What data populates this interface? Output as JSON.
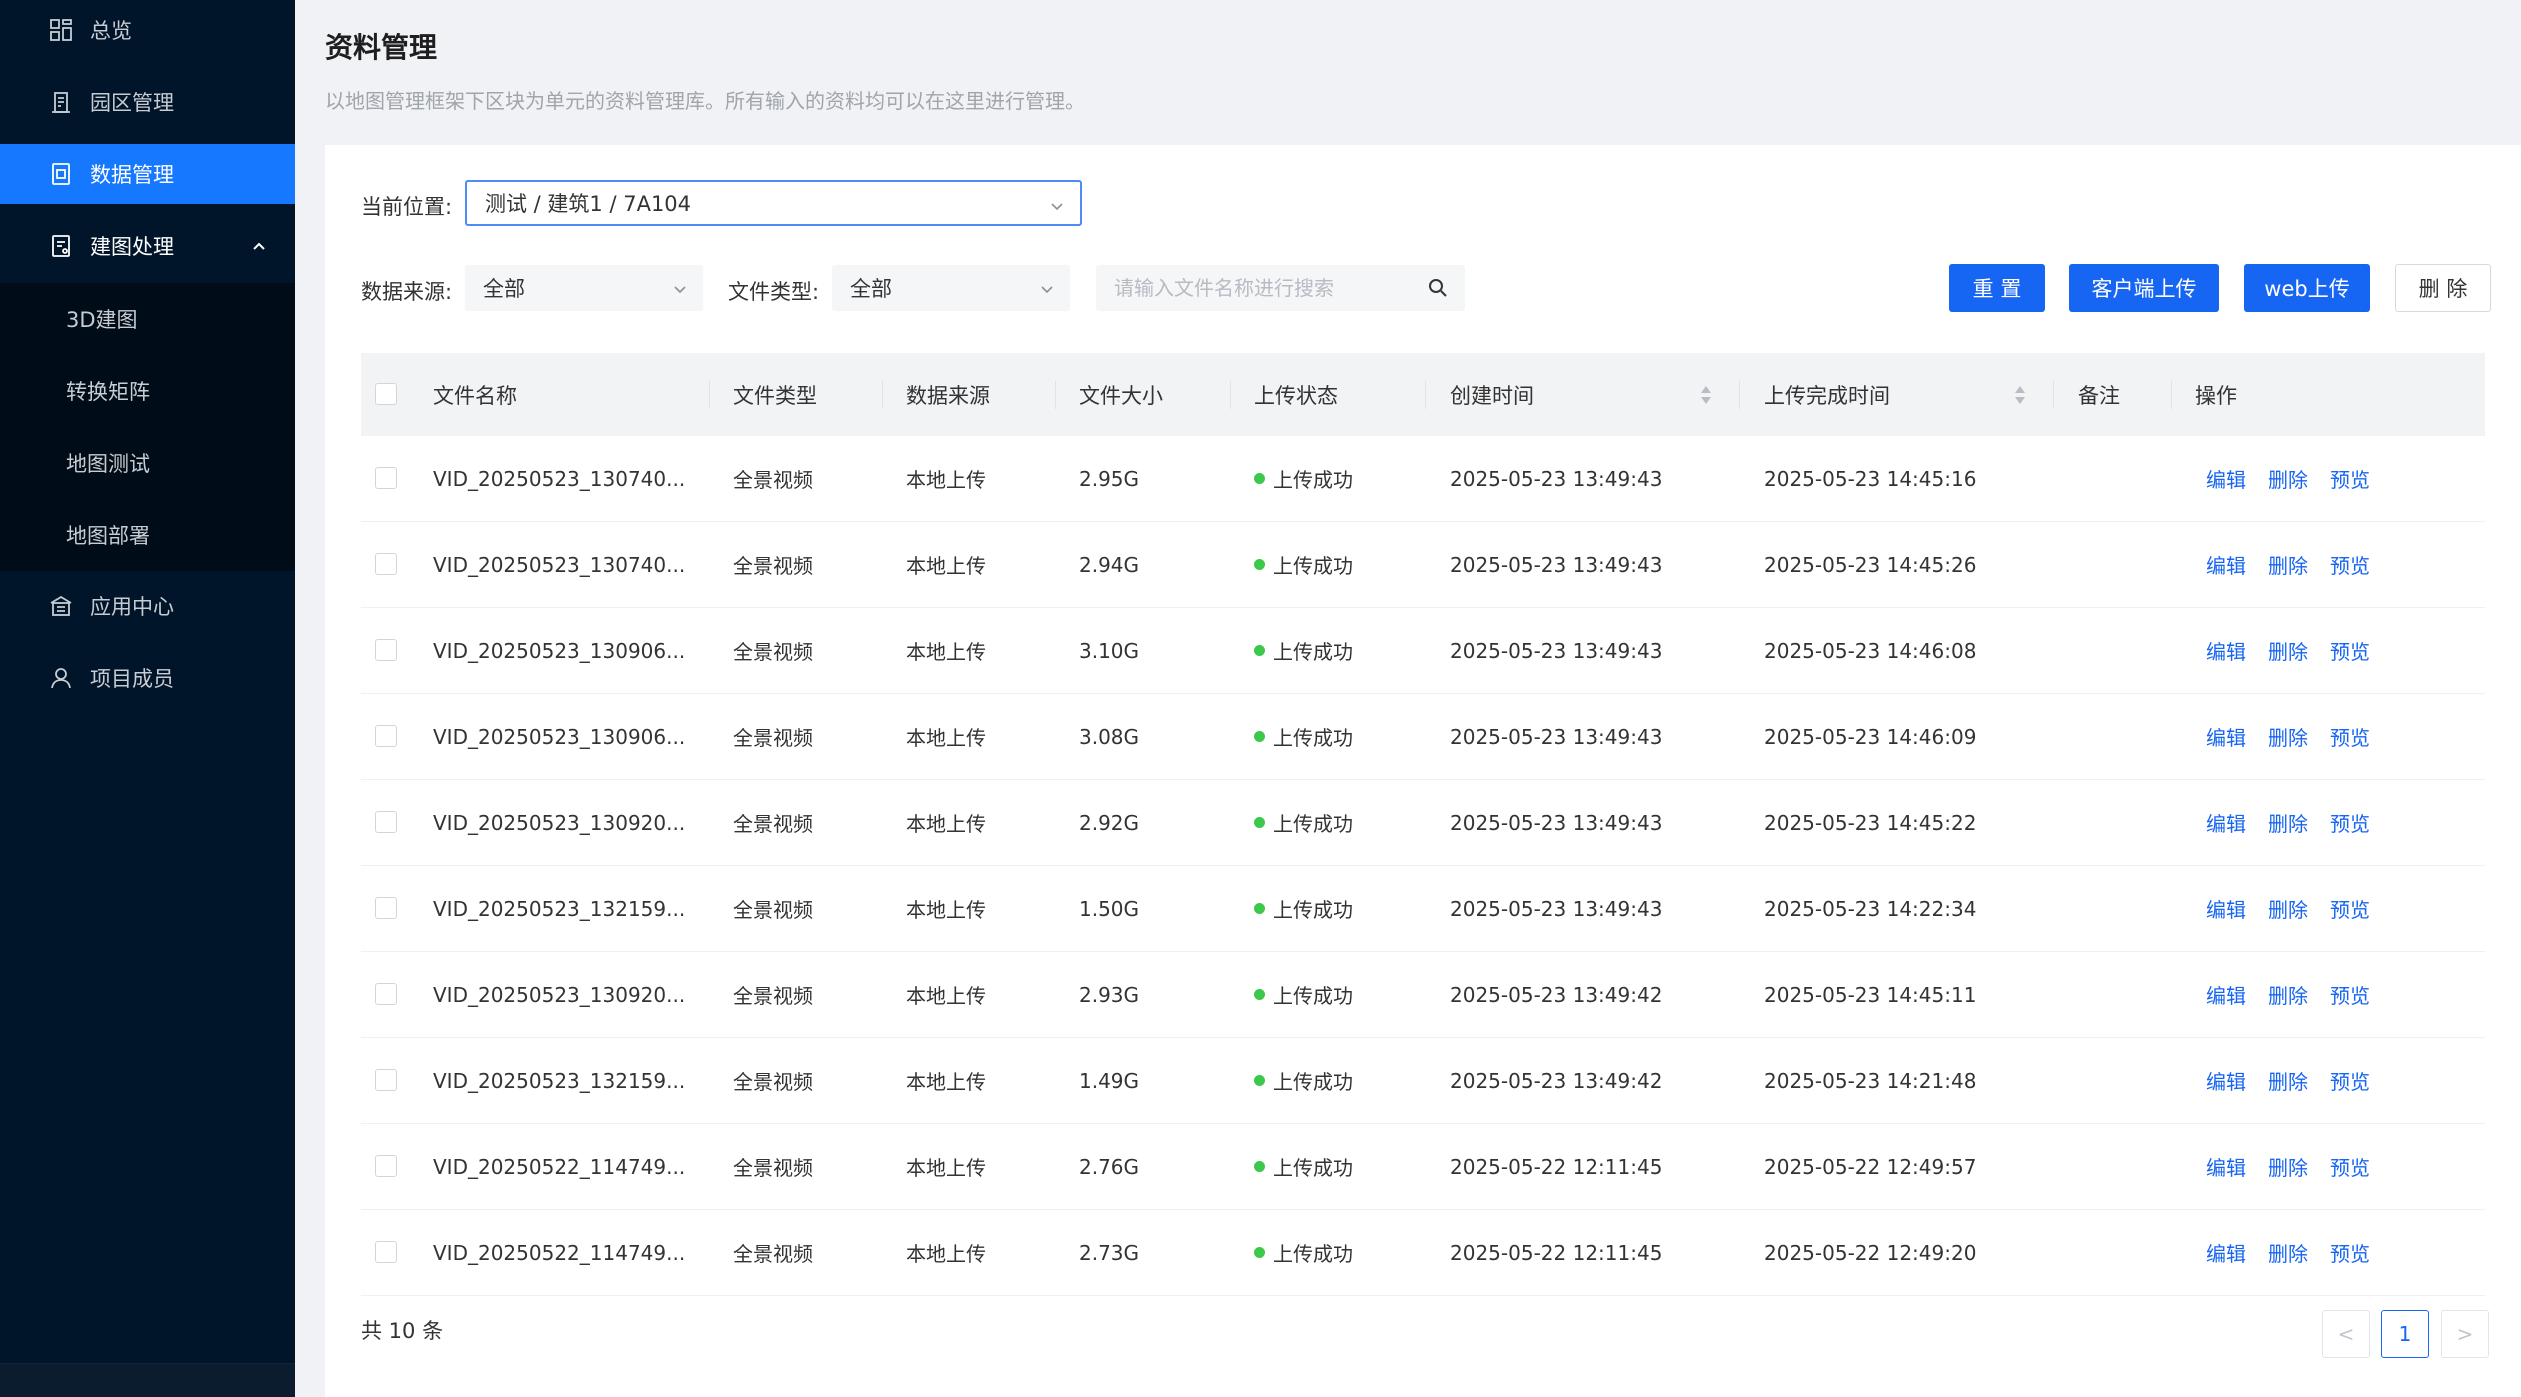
{
  "sidebar": {
    "items": [
      {
        "label": "总览",
        "icon": "dashboard-icon"
      },
      {
        "label": "园区管理",
        "icon": "building-icon"
      },
      {
        "label": "数据管理",
        "icon": "document-icon"
      },
      {
        "label": "建图处理",
        "icon": "map-process-icon"
      },
      {
        "label": "应用中心",
        "icon": "app-center-icon"
      },
      {
        "label": "项目成员",
        "icon": "user-icon"
      }
    ],
    "submenu": [
      "3D建图",
      "转换矩阵",
      "地图测试",
      "地图部署"
    ]
  },
  "header": {
    "title": "资料管理",
    "description": "以地图管理框架下区块为单元的资料管理库。所有输入的资料均可以在这里进行管理。"
  },
  "filters": {
    "location_label": "当前位置:",
    "location_value": "测试 / 建筑1 / 7A104",
    "source_label": "数据来源:",
    "source_value": "全部",
    "type_label": "文件类型:",
    "type_value": "全部",
    "search_placeholder": "请输入文件名称进行搜索"
  },
  "buttons": {
    "reset": "重 置",
    "client_upload": "客户端上传",
    "web_upload": "web上传",
    "delete": "删 除"
  },
  "table": {
    "columns": [
      "文件名称",
      "文件类型",
      "数据来源",
      "文件大小",
      "上传状态",
      "创建时间",
      "上传完成时间",
      "备注",
      "操作"
    ],
    "actions": [
      "编辑",
      "删除",
      "预览"
    ],
    "rows": [
      {
        "name": "VID_20250523_130740...",
        "type": "全景视频",
        "source": "本地上传",
        "size": "2.95G",
        "status": "上传成功",
        "created": "2025-05-23 13:49:43",
        "finished": "2025-05-23 14:45:16",
        "note": ""
      },
      {
        "name": "VID_20250523_130740...",
        "type": "全景视频",
        "source": "本地上传",
        "size": "2.94G",
        "status": "上传成功",
        "created": "2025-05-23 13:49:43",
        "finished": "2025-05-23 14:45:26",
        "note": ""
      },
      {
        "name": "VID_20250523_130906...",
        "type": "全景视频",
        "source": "本地上传",
        "size": "3.10G",
        "status": "上传成功",
        "created": "2025-05-23 13:49:43",
        "finished": "2025-05-23 14:46:08",
        "note": ""
      },
      {
        "name": "VID_20250523_130906...",
        "type": "全景视频",
        "source": "本地上传",
        "size": "3.08G",
        "status": "上传成功",
        "created": "2025-05-23 13:49:43",
        "finished": "2025-05-23 14:46:09",
        "note": ""
      },
      {
        "name": "VID_20250523_130920...",
        "type": "全景视频",
        "source": "本地上传",
        "size": "2.92G",
        "status": "上传成功",
        "created": "2025-05-23 13:49:43",
        "finished": "2025-05-23 14:45:22",
        "note": ""
      },
      {
        "name": "VID_20250523_132159...",
        "type": "全景视频",
        "source": "本地上传",
        "size": "1.50G",
        "status": "上传成功",
        "created": "2025-05-23 13:49:43",
        "finished": "2025-05-23 14:22:34",
        "note": ""
      },
      {
        "name": "VID_20250523_130920...",
        "type": "全景视频",
        "source": "本地上传",
        "size": "2.93G",
        "status": "上传成功",
        "created": "2025-05-23 13:49:42",
        "finished": "2025-05-23 14:45:11",
        "note": ""
      },
      {
        "name": "VID_20250523_132159...",
        "type": "全景视频",
        "source": "本地上传",
        "size": "1.49G",
        "status": "上传成功",
        "created": "2025-05-23 13:49:42",
        "finished": "2025-05-23 14:21:48",
        "note": ""
      },
      {
        "name": "VID_20250522_114749...",
        "type": "全景视频",
        "source": "本地上传",
        "size": "2.76G",
        "status": "上传成功",
        "created": "2025-05-22 12:11:45",
        "finished": "2025-05-22 12:49:57",
        "note": ""
      },
      {
        "name": "VID_20250522_114749...",
        "type": "全景视频",
        "source": "本地上传",
        "size": "2.73G",
        "status": "上传成功",
        "created": "2025-05-22 12:11:45",
        "finished": "2025-05-22 12:49:20",
        "note": ""
      }
    ]
  },
  "pagination": {
    "total_text": "共 10 条",
    "current_page": "1",
    "prev_symbol": "<",
    "next_symbol": ">"
  },
  "colors": {
    "sidebar_bg": "#001529",
    "accent": "#1765f3",
    "success": "#3cc84a"
  }
}
